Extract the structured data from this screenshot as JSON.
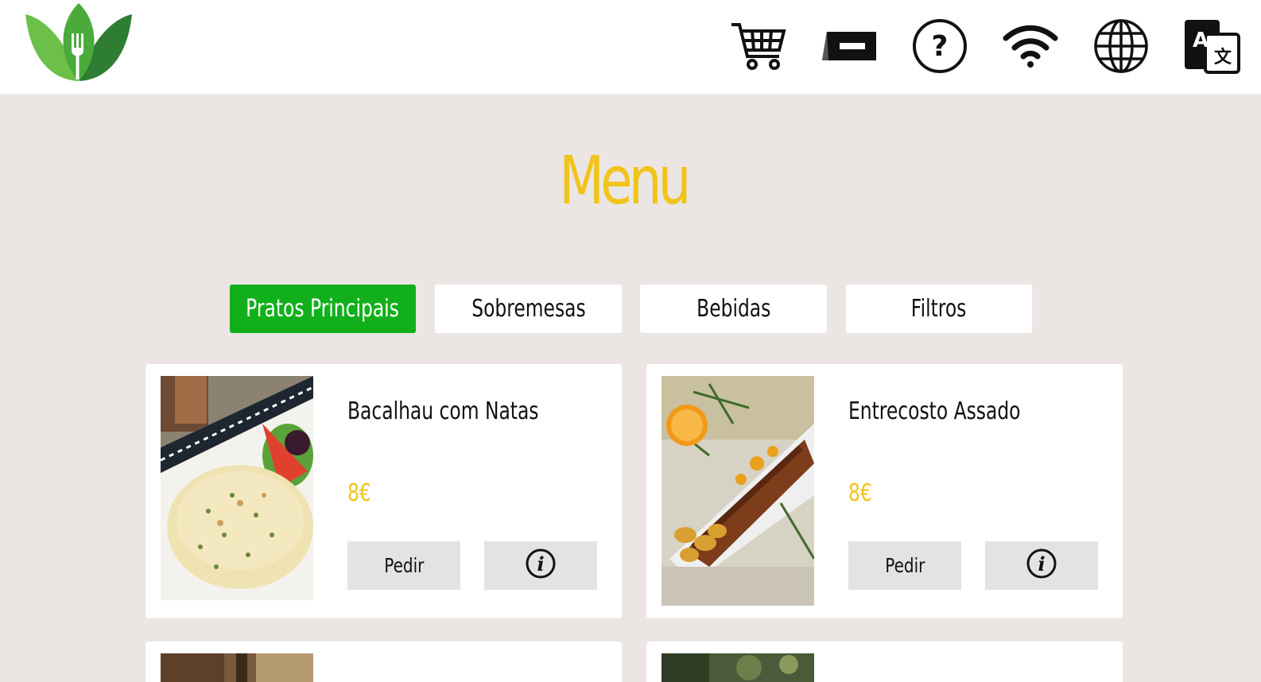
{
  "header": {
    "icons": [
      "logo-icon",
      "cart-icon",
      "ticket-icon",
      "help-icon",
      "wifi-icon",
      "globe-icon",
      "translate-icon"
    ]
  },
  "page_title": "Menu",
  "tabs": [
    {
      "label": "Pratos Principais",
      "active": true
    },
    {
      "label": "Sobremesas",
      "active": false
    },
    {
      "label": "Bebidas",
      "active": false
    },
    {
      "label": "Filtros",
      "active": false
    }
  ],
  "dishes": [
    {
      "name": "Bacalhau com Natas",
      "price": "8€",
      "order_label": "Pedir",
      "info_icon": "info-icon"
    },
    {
      "name": "Entrecosto Assado",
      "price": "8€",
      "order_label": "Pedir",
      "info_icon": "info-icon"
    }
  ],
  "colors": {
    "accent": "#f0c419",
    "active_tab": "#11b01b",
    "background": "#ebe5e4",
    "button": "#e5e2e2"
  }
}
